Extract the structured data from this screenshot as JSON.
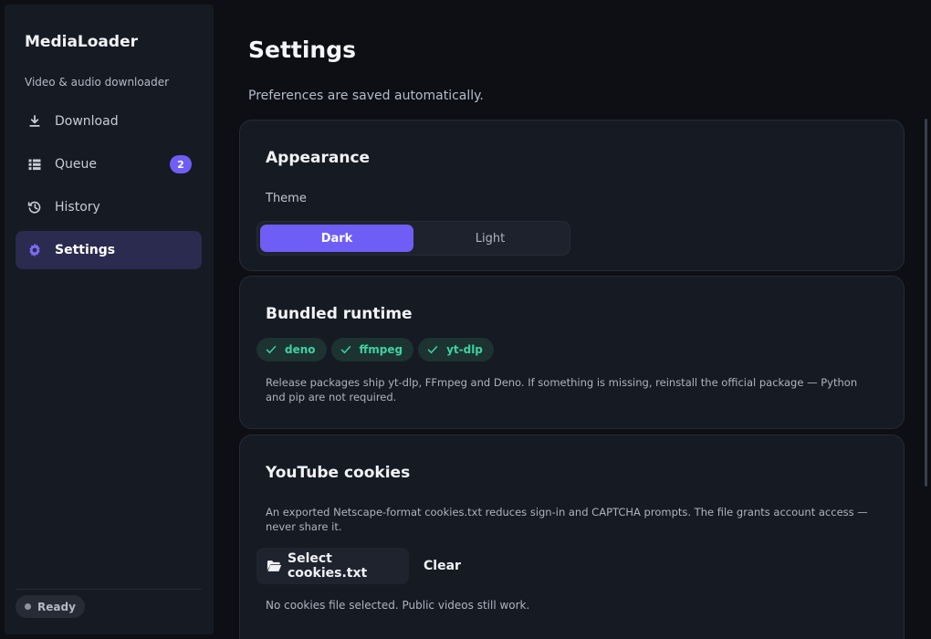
{
  "app": {
    "name": "MediaLoader",
    "tagline": "Video & audio downloader",
    "status": "Ready"
  },
  "sidebar": {
    "items": [
      {
        "label": "Download",
        "icon": "download-icon"
      },
      {
        "label": "Queue",
        "icon": "list-icon",
        "badge": "2"
      },
      {
        "label": "History",
        "icon": "history-icon"
      },
      {
        "label": "Settings",
        "icon": "gear-icon",
        "active": true
      }
    ]
  },
  "page": {
    "title": "Settings",
    "subtitle": "Preferences are saved automatically."
  },
  "appearance": {
    "title": "Appearance",
    "theme_label": "Theme",
    "options": [
      "Dark",
      "Light"
    ],
    "selected": "Dark"
  },
  "runtime": {
    "title": "Bundled runtime",
    "components": [
      "deno",
      "ffmpeg",
      "yt-dlp"
    ],
    "description": "Release packages ship yt-dlp, FFmpeg and Deno. If something is missing, reinstall the official package — Python and pip are not required."
  },
  "cookies": {
    "title": "YouTube cookies",
    "description": "An exported Netscape-format cookies.txt reduces sign-in and CAPTCHA prompts. The file grants account access — never share it.",
    "select_label": "Select cookies.txt",
    "clear_label": "Clear",
    "status": "No cookies file selected. Public videos still work."
  },
  "colors": {
    "accent": "#6f5ef5",
    "success": "#3fd1a0",
    "background": "#0d0f14",
    "panel": "#161a23"
  }
}
